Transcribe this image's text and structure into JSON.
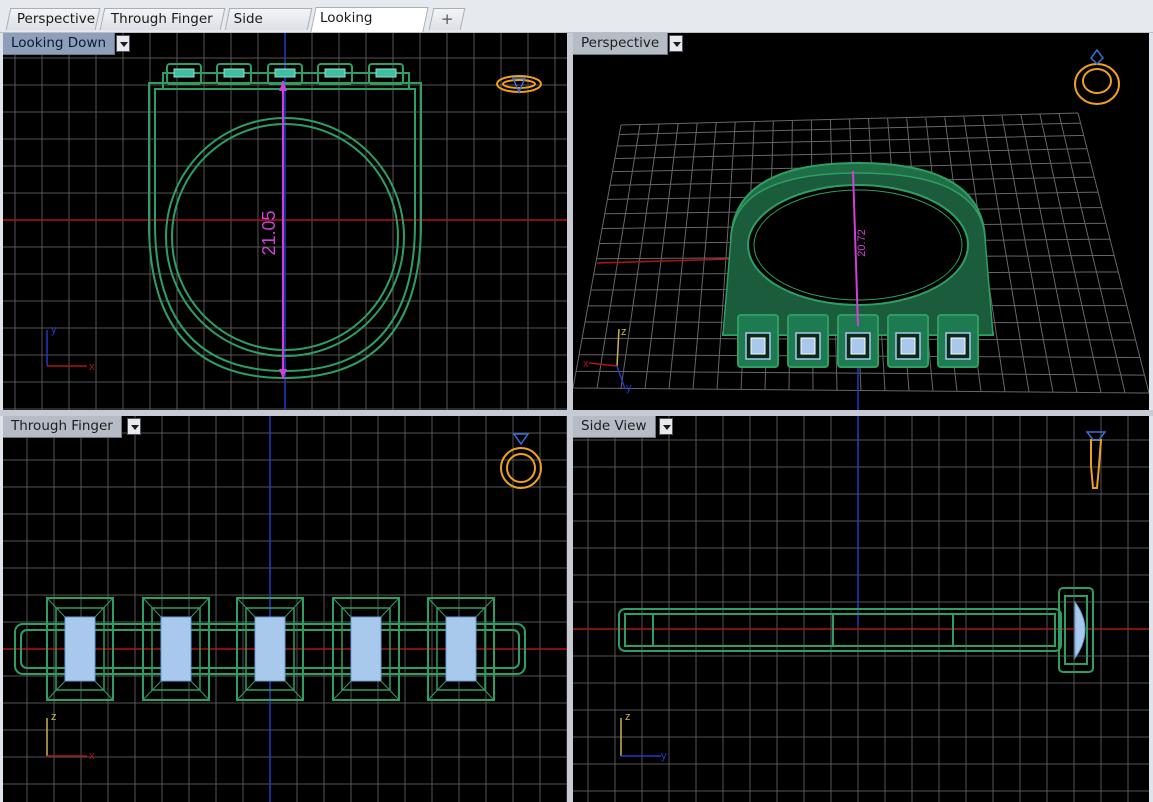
{
  "tabs": [
    {
      "label": "Perspective",
      "active": false
    },
    {
      "label": "Through Finger",
      "active": false
    },
    {
      "label": "Side View",
      "active": false
    },
    {
      "label": "Looking Down",
      "active": true
    }
  ],
  "add_tab_glyph": "+",
  "viewports": {
    "top_left": {
      "label": "Looking Down",
      "active": true,
      "dimension": "21.05",
      "axes": [
        "y",
        "x"
      ],
      "nav_icon": "ring-top-icon"
    },
    "top_right": {
      "label": "Perspective",
      "active": false,
      "dimension": "20.72",
      "axes": [
        "z",
        "x",
        "y"
      ],
      "nav_icon": "ring-perspective-icon"
    },
    "bottom_left": {
      "label": "Through Finger",
      "active": false,
      "axes": [
        "z",
        "x"
      ],
      "nav_icon": "ring-front-icon"
    },
    "bottom_right": {
      "label": "Side View",
      "active": false,
      "axes": [
        "z",
        "y"
      ],
      "nav_icon": "ring-side-icon"
    }
  },
  "colors": {
    "model_green": "#2e9e62",
    "stone_blue": "#a8c8ec",
    "dimension_magenta": "#d040d8",
    "x_axis_red": "#b01414",
    "y_axis_blue": "#1e3cc8",
    "nav_icon_orange": "#f0a020",
    "grid_gray": "#555555",
    "viewport_bg": "#000000"
  }
}
